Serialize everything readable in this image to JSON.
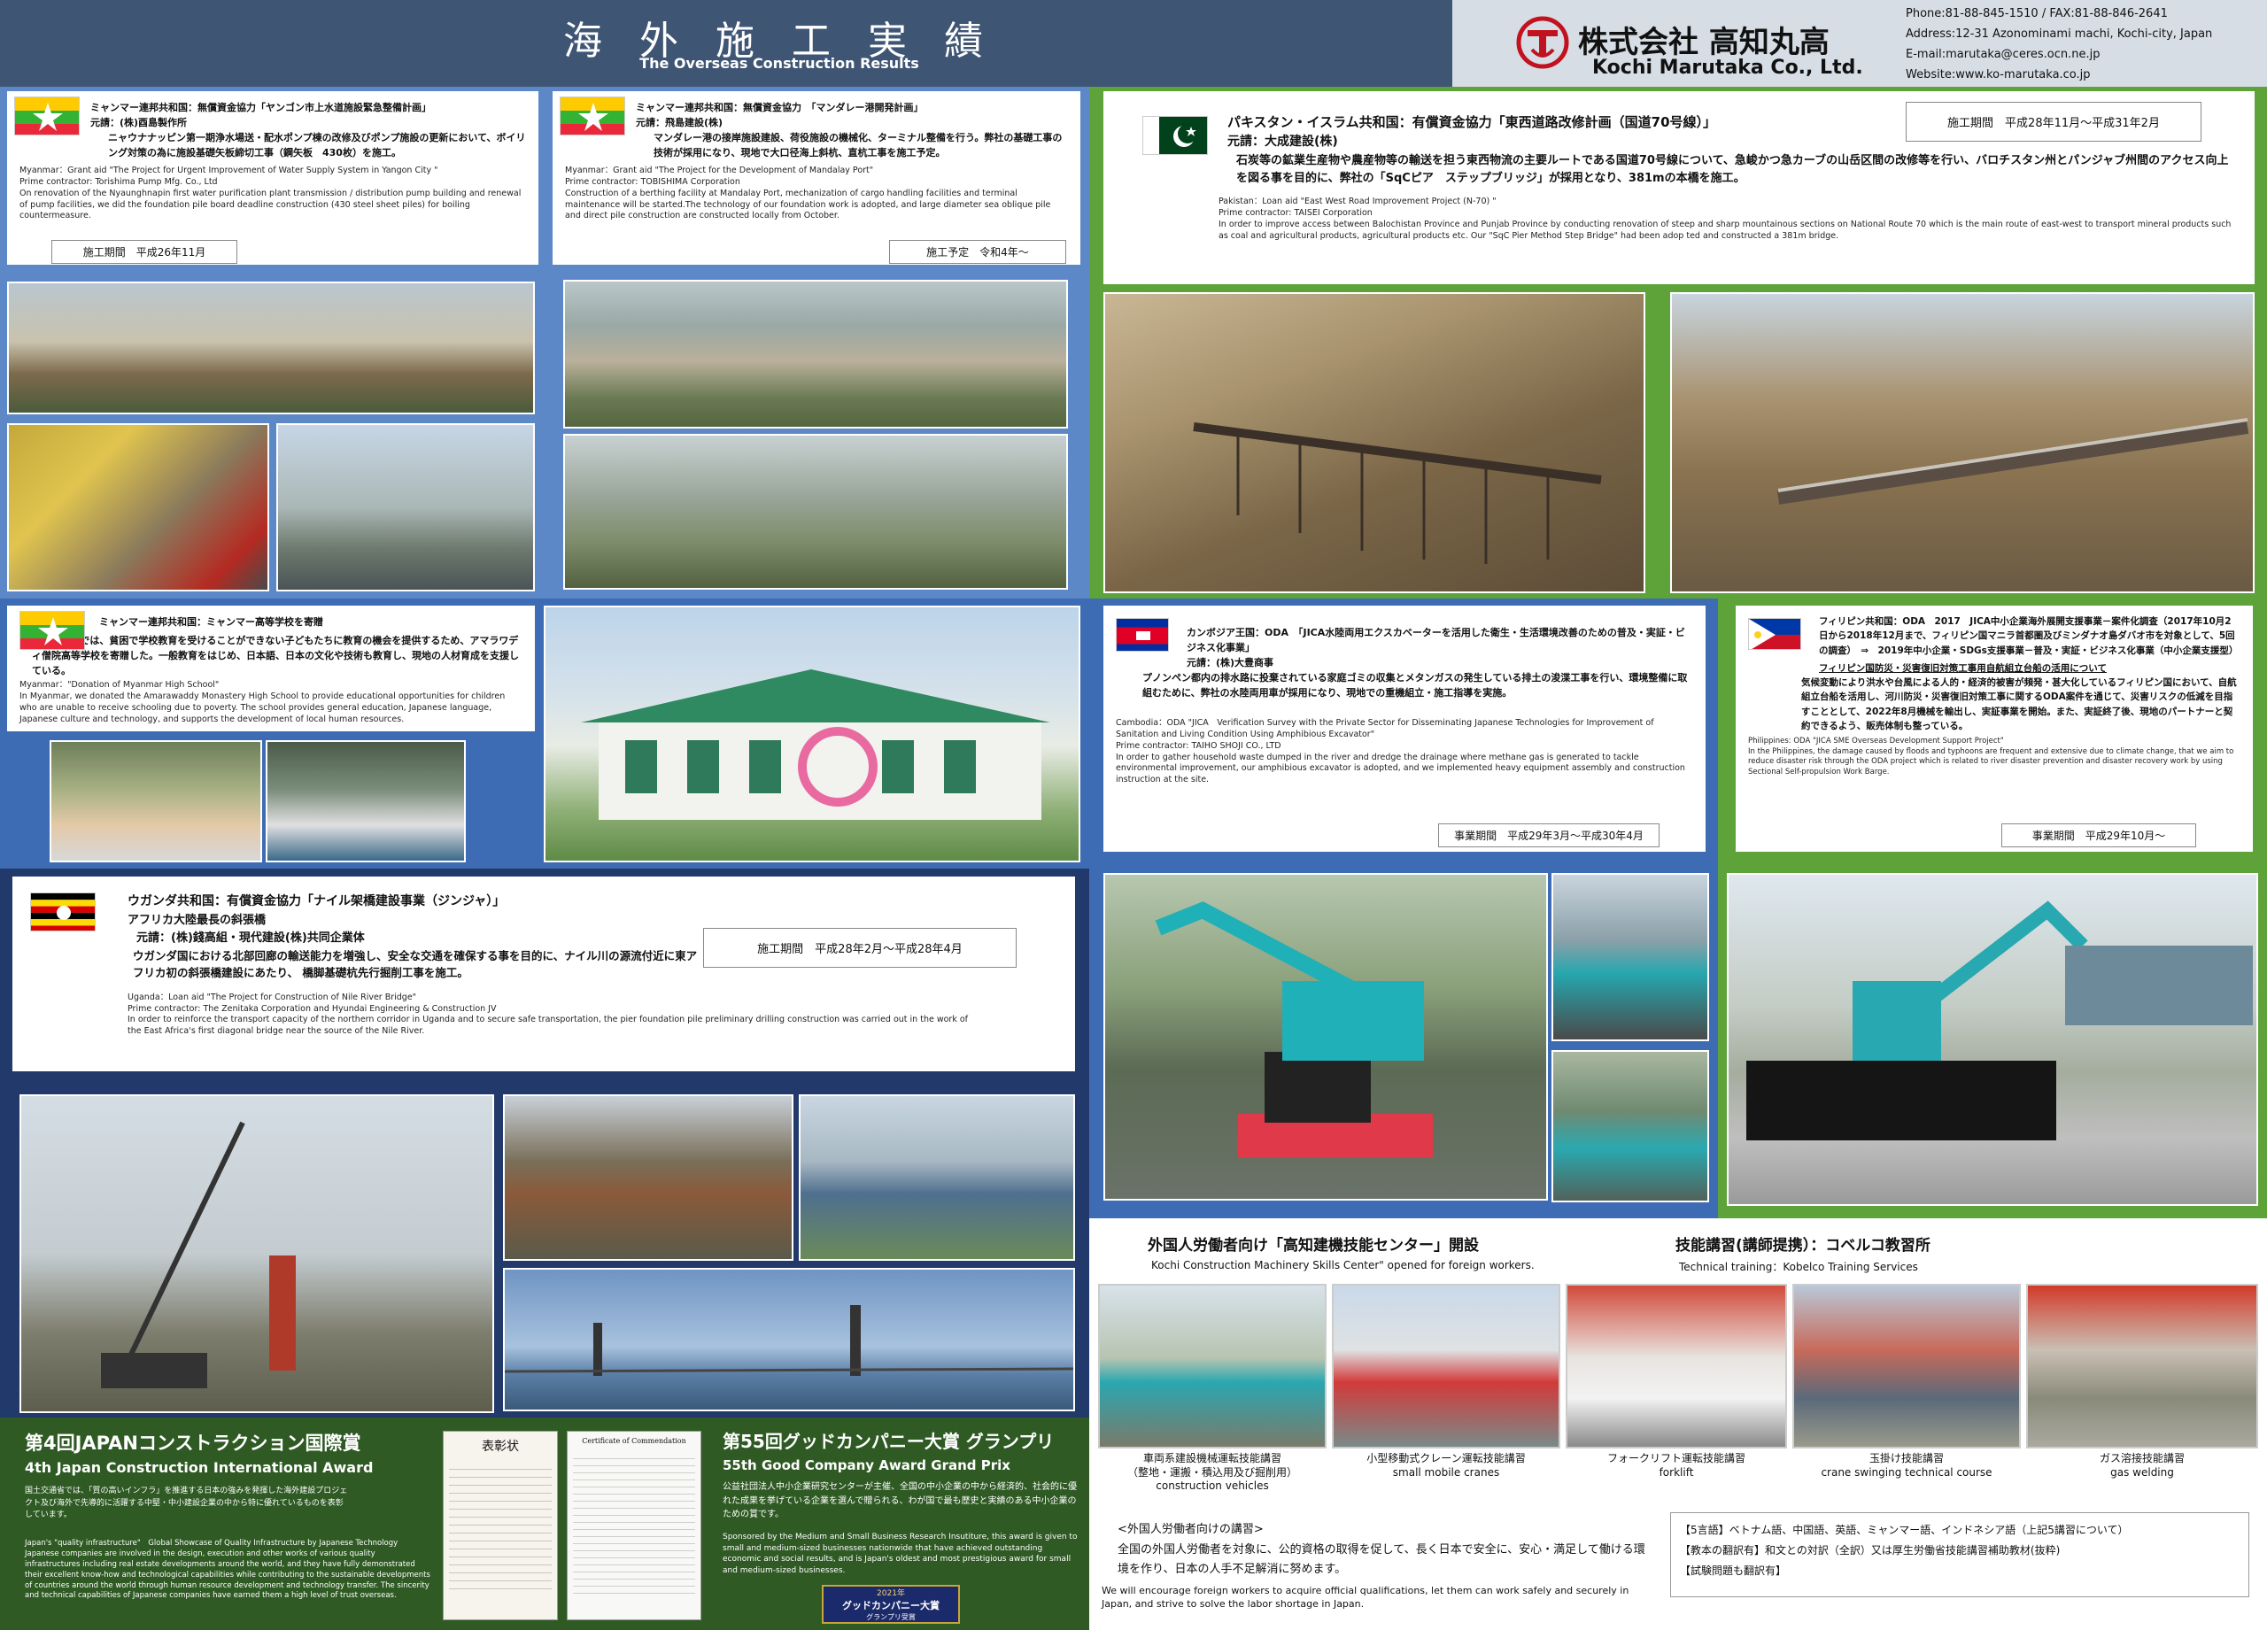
{
  "header": {
    "title_jp": "海 外 施 工 実 績",
    "title_en": "The Overseas Construction Results",
    "company_jp": "株式会社 高知丸高",
    "company_en": "Kochi Marutaka Co., Ltd.",
    "phone": "Phone:81-88-845-1510 / FAX:81-88-846-2641",
    "address": "Address:12-31 Azonominami machi, Kochi-city, Japan",
    "email": "E-mail:marutaka@ceres.ocn.ne.jp",
    "website": "Website:www.ko-marutaka.co.jp"
  },
  "projects": {
    "yangon": {
      "title": "ミャンマー連邦共和国：無償資金協力「ヤンゴン市上水道施設緊急整備計画」",
      "contractor": "元請：(株)酉島製作所",
      "body_jp": "ニャウナナッピン第一期浄水場送・配水ポンプ棟の改修及びポンプ施設の更新において、ボイリング対策の為に施設基礎矢板締切工事（鋼矢板　430枚）を施工。",
      "en_grant": "Myanmar：Grant aid \"The Project for Urgent Improvement of Water Supply System in Yangon City \"",
      "en_contractor": "Prime contractor: Torishima Pump Mfg. Co., Ltd",
      "en_body": "On renovation of the Nyaunghnapin first water purification plant transmission / distribution pump building and renewal of pump facilities, we  did the foundation pile board deadline construction (430 steel sheet piles) for boiling countermeasure.",
      "period": "施工期間　平成26年11月"
    },
    "mandalay": {
      "title": "ミャンマー連邦共和国：無償資金協力　「マンダレー港開発計画」",
      "contractor": "元請：飛島建設(株)",
      "body_jp": "マンダレー港の接岸施設建設、荷役施設の機械化、ターミナル整備を行う。弊社の基礎工事の技術が採用になり、現地で大口径海上斜杭、直杭工事を施工予定。",
      "en_grant": "Myanmar：Grant aid \"The Project for the Development of Mandalay Port\"",
      "en_contractor": "Prime contractor: TOBISHIMA Corporation",
      "en_body": "Construction of a berthing facility at Mandalay Port, mechanization of cargo handling facilities and terminal maintenance will be started.The technology of our foundation work is adopted, and large diameter sea oblique pile and direct pile construction are constructed locally from October.",
      "period": "施工予定　令和4年～"
    },
    "pakistan": {
      "title": "パキスタン・イスラム共和国：有償資金協力「東西道路改修計画（国道70号線）」",
      "contractor": "元請：大成建設(株)",
      "body_jp": "石炭等の鉱業生産物や農産物等の輸送を担う東西物流の主要ルートである国道70号線について、急峻かつ急カーブの山岳区間の改修等を行い、バロチスタン州とパンジャブ州間のアクセス向上を図る事を目的に、弊社の「SqCピア　ステップブリッジ」が採用となり、381mの本橋を施工。",
      "en_grant": "Pakistan：Loan aid \"East West Road Improvement Project (N-70) \"",
      "en_contractor": "Prime contractor: TAISEI Corporation",
      "en_body": "In order to  improve access between Balochistan Province and Punjab Province by conducting renovation of steep and sharp mountainous sections on National Route 70 which is the main route of east-west to transport  mineral products such as coal and agricultural products, agricultural products etc. Our  \"SqC Pier Method  Step Bridge\" had been adop ted and constructed  a 381m  bridge.",
      "period": "施工期間　平成28年11月～平成31年2月"
    },
    "school": {
      "title": "ミャンマー連邦共和国：ミャンマー高等学校を寄贈",
      "body_jp": "ミャンマーでは、貧困で学校教育を受けることができない子どもたちに教育の機会を提供するため、アマラワディ僧院高等学校を寄贈した。一般教育をはじめ、日本語、日本の文化や技術も教育し、現地の人材育成を支援している。",
      "en_grant": "Myanmar：\"Donation of Myanmar High School\"",
      "en_body": "In Myanmar, we donated the Amarawaddy Monastery High School to provide educational opportunities for children who are unable to receive schooling due to poverty. The school provides general education, Japanese language, Japanese culture and technology, and supports the development of local human resources."
    },
    "cambodia": {
      "title": "カンボジア王国：ODA　「JICA水陸両用エクスカベーターを活用した衛生・生活環境改善のための普及・実証・ビジネス化事業」",
      "contractor": "元請：(株)大豊商事",
      "body_jp": "プノンペン都内の排水路に投棄されている家庭ゴミの収集とメタンガスの発生している排土の浚渫工事を行い、環境整備に取組むために、弊社の水陸両用車が採用になり、現地での重機組立・施工指導を実施。",
      "en_grant": "Cambodia：ODA \"JICA　Verification Survey with the Private Sector for Disseminating Japanese Technologies for Improvement of Sanitation and Living Condition Using Amphibious Excavator\"",
      "en_contractor": "Prime contractor: TAIHO SHOJI CO., LTD",
      "en_body": "In order to gather household waste dumped in the river and dredge the drainage where methane gas is generated to tackle environmental improvement,  our amphibious excavator is adopted, and we implemented heavy equipment assembly and construction instruction at the site.",
      "period": "事業期間　平成29年3月～平成30年4月"
    },
    "philippines": {
      "title": "フィリピン共和国：ODA　2017　JICA中小企業海外展開支援事業－案件化調査（2017年10月2日から2018年12月まで、フィリピン国マニラ首都圏及びミンダナオ島ダバオ市を対象として、5回の調査）　⇒　2019年中小企業・SDGs支援事業－普及・実証・ビジネス化事業（中小企業支援型）",
      "subtitle": "フィリピン国防災・災害復旧対策工事用自航組立台船の活用について",
      "body_jp": "気候変動により洪水や台風による人的・経済的被害が頻発・甚大化しているフィリピン国において、自航組立台船を活用し、河川防災・災害復旧対策工事に関するODA案件を通じて、災害リスクの低減を目指すこととして、2022年8月機械を輸出し、実証事業を開始。また、実証終了後、現地のパートナーと契約できるよう、販売体制も整っている。",
      "en_grant": "Philippines: ODA \"JICA SME Overseas Development Support Project\"",
      "en_body": "In the Philippines, the damage caused by floods and typhoons are frequent and extensive due to climate change, that we aim to reduce disaster risk through the ODA project which is related to river disaster prevention and disaster recovery work by using Sectional Self-propulsion Work Barge.",
      "period": "事業期間　平成29年10月～"
    },
    "uganda": {
      "title": "ウガンダ共和国：有償資金協力「ナイル架橋建設事業（ジンジャ）」",
      "subtitle": "アフリカ大陸最長の斜張橋",
      "contractor": "元請：(株)錢高組・現代建設(株)共同企業体",
      "body_jp": "ウガンダ国における北部回廊の輸送能力を増強し、安全な交通を確保する事を目的に、ナイル川の源流付近に東アフリカ初の斜張橋建設にあたり、 橋脚基礎杭先行掘削工事を施工。",
      "en_grant": "Uganda：Loan aid \"The Project for Construction of Nile River Bridge\"",
      "en_contractor": "Prime contractor: The Zenitaka Corporation and  Hyundai Engineering & Construction JV",
      "en_body": "In order to reinforce the transport capacity of the northern corridor in Uganda and to secure safe transportation, the pier foundation pile preliminary drilling construction was carried out in the work of the East Africa's first diagonal bridge near the source of the Nile River.",
      "period": "施工期間　平成28年2月～平成28年4月"
    }
  },
  "awards": {
    "award1_jp": "第4回JAPANコンストラクション国際賞",
    "award1_en": "4th Japan Construction International Award",
    "award1_body": "国土交通省では、「質の高いインフラ」を推進する日本の強みを発揮した海外建設プロジェクト及び海外で先導的に活躍する中堅・中小建設企業の中から特に優れているものを表彰しています。",
    "award1_en_body": "Japan's \"quality infrastructure\"　Global Showcase of Quality Infrastructure by Japanese Technology Japanese companies are involved in the design, execution and other works of various quality infrastructures including real estate developments around the world, and they have fully demonstrated their excellent know-how and technological capabilities while contributing to the sustainable developments of countries around the world through human resource development and technology transfer. The sincerity and technical capabilities of Japanese companies have earned them a high level of trust overseas.",
    "cert1_title": "表彰状",
    "cert2_title": "Certificate of Commendation",
    "award2_jp": "第55回グッドカンパニー大賞 グランプリ",
    "award2_en": "55th Good Company Award Grand Prix",
    "award2_body": "公益社団法人中小企業研究センターが主催、全国の中小企業の中から経済的、社会的に優れた成果を挙げている企業を選んで贈られる、わが国で最も歴史と実績のある中小企業のための賞です。",
    "award2_en_body": "Sponsored by the Medium and Small Business Research Insutiture, this award is given to small and medium-sized businesses nationwide that have achieved outstanding economic and social results, and is Japan's oldest and most prestigious award for small and medium-sized businesses.",
    "badge_year": "2021年",
    "badge_text": "グッドカンパニー大賞",
    "badge_sub": "グランプリ受賞"
  },
  "training": {
    "center_title": "外国人労働者向け「高知建機技能センター」開設",
    "center_en": "Kochi Construction Machinery Skills Center\" opened for foreign workers.",
    "kobelco_title": "技能講習(講師提携）：コベルコ教習所",
    "kobelco_en": "Technical training：Kobelco Training Services",
    "courses": [
      {
        "jp": "車両系建設機械運転技能講習\n（整地・運搬・積込用及び掘削用）",
        "en": "construction vehicles"
      },
      {
        "jp": "小型移動式クレーン運転技能講習",
        "en": "small mobile cranes"
      },
      {
        "jp": "フォークリフト運転技能講習",
        "en": "forklift"
      },
      {
        "jp": "玉掛け技能講習",
        "en": "crane swinging technical course"
      },
      {
        "jp": "ガス溶接技能講習",
        "en": "gas welding"
      }
    ],
    "note_title": "<外国人労働者向けの講習>",
    "note_jp": "全国の外国人労働者を対象に、公的資格の取得を促して、長く日本で安全に、安心・満足して働ける環境を作り、日本の人手不足解消に努めます。",
    "note_en": "We will encourage foreign workers to acquire official qualifications, let them can work safely and securely in Japan, and strive to solve the labor shortage in Japan.",
    "lang1": "【5言語】ベトナム語、中国語、英語、ミャンマー語、インドネシア語（上記5講習について）",
    "lang2": "【教本の翻訳有】和文との対訳（全訳）又は厚生労働省技能講習補助教材(抜粋)",
    "lang3": "【試験問題も翻訳有】"
  },
  "colors": {
    "navy": "#3f5574",
    "blue": "#3d6cb4",
    "green": "#5ea33a",
    "darkblue": "#213a6b",
    "darkgreen": "#2f5a24"
  }
}
